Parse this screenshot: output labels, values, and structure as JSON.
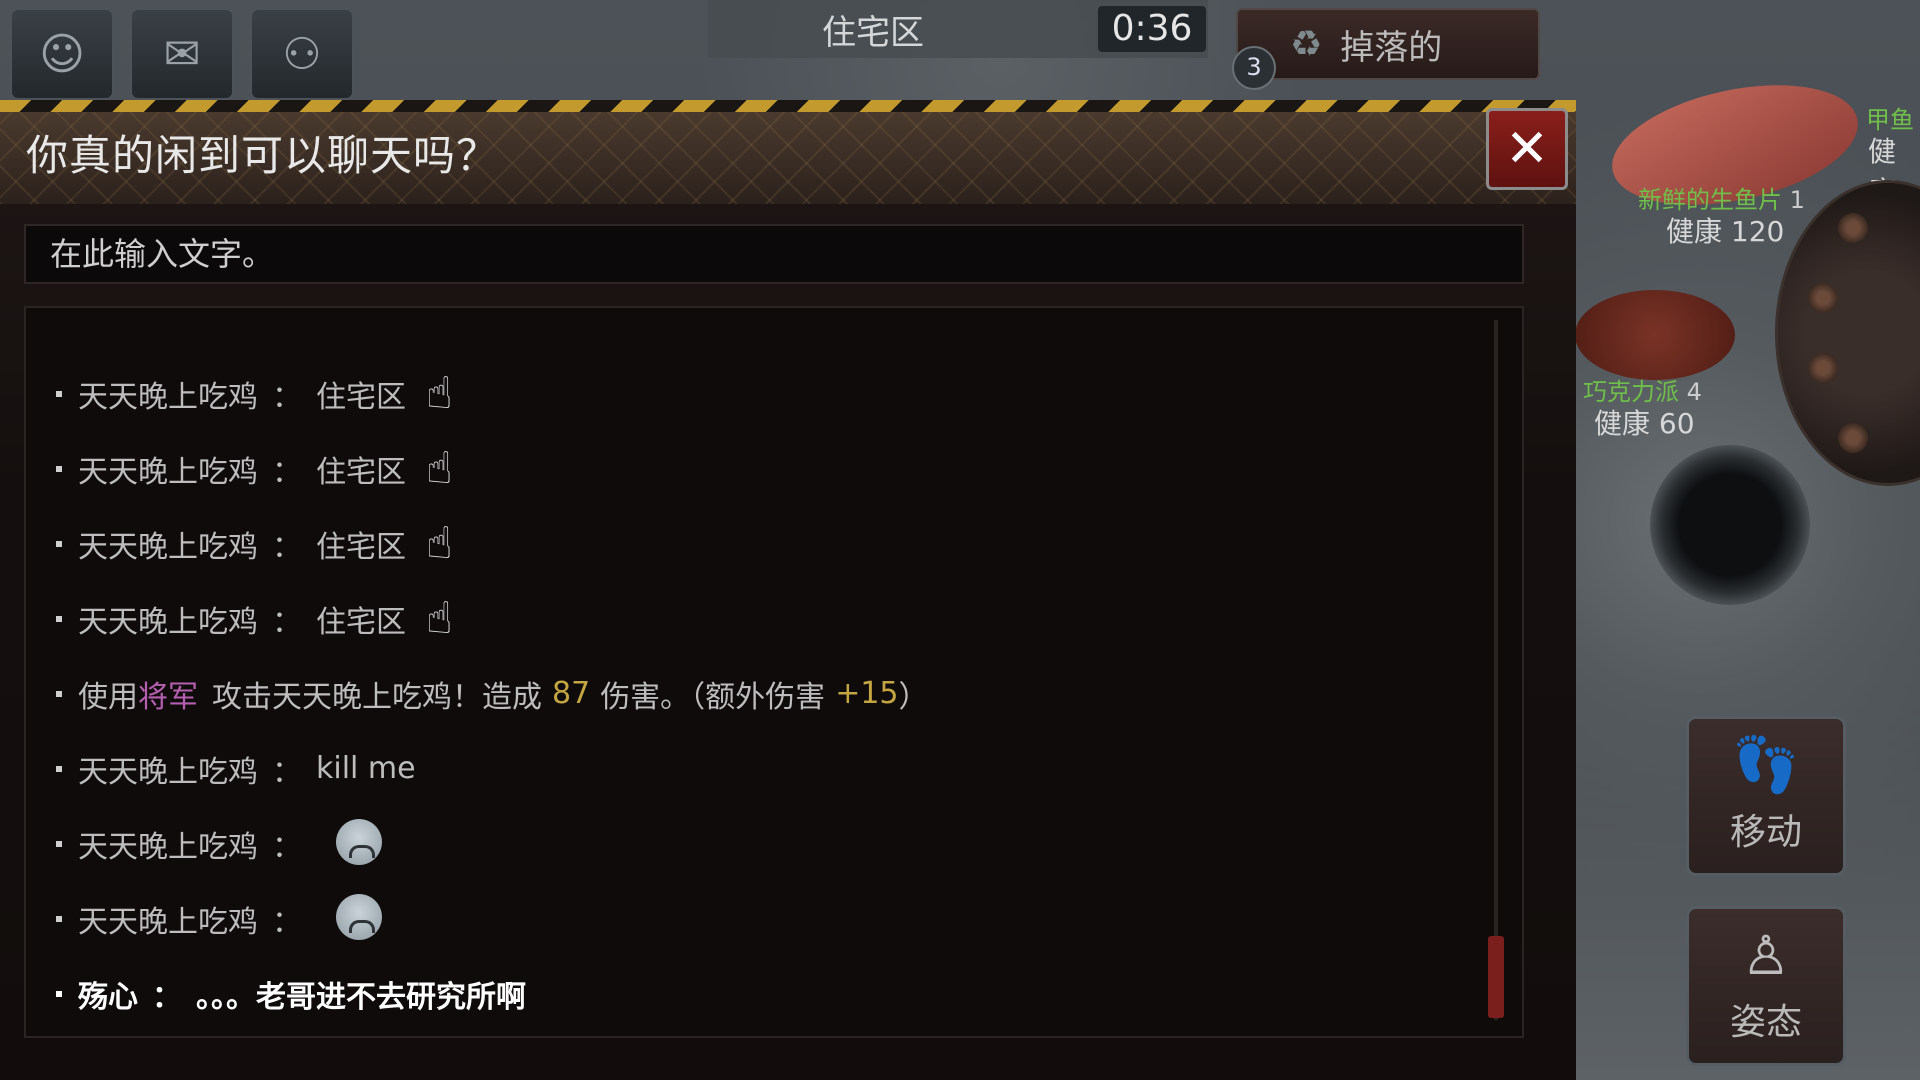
{
  "hud": {
    "top_icons": [
      "face-icon",
      "chat-bubble-icon",
      "people-icon"
    ],
    "location": "住宅区",
    "timer": "0:36",
    "drop_button": {
      "label": "掉落的",
      "count": "3"
    }
  },
  "right_panel": {
    "items": [
      {
        "name": "新鲜的生鱼片",
        "qty": "1",
        "health_label": "健康",
        "health": "120"
      },
      {
        "name": "巧克力派",
        "qty": "4",
        "health_label": "健康",
        "health": "60"
      }
    ],
    "partial_item_name": "甲鱼",
    "partial_health_label": "健康",
    "actions": [
      {
        "label": "移动",
        "icon": "footprints-icon"
      },
      {
        "label": "姿态",
        "icon": "person-icon"
      }
    ]
  },
  "chat": {
    "title": "你真的闲到可以聊天吗？",
    "close_symbol": "✕",
    "input_placeholder": "在此输入文字。",
    "messages": [
      {
        "sender": "天天晚上吃鸡",
        "sep": "：",
        "text": "住宅区",
        "emoji": "hand-icon"
      },
      {
        "sender": "天天晚上吃鸡",
        "sep": "：",
        "text": "住宅区",
        "emoji": "hand-icon"
      },
      {
        "sender": "天天晚上吃鸡",
        "sep": "：",
        "text": "住宅区",
        "emoji": "hand-icon"
      },
      {
        "sender": "天天晚上吃鸡",
        "sep": "：",
        "text": "住宅区",
        "emoji": "hand-icon"
      },
      {
        "sender": "天天晚上吃鸡",
        "sep": "：",
        "text": "kill me",
        "emoji": ""
      },
      {
        "sender": "天天晚上吃鸡",
        "sep": "：",
        "text": "",
        "emoji": "crying-face-icon"
      },
      {
        "sender": "天天晚上吃鸡",
        "sep": "：",
        "text": "",
        "emoji": "crying-face-icon"
      }
    ],
    "combat_message": {
      "prefix": "使用",
      "weapon": "将军",
      "middle": "攻击天天晚上吃鸡！造成",
      "damage": "87",
      "suffix": "伤害。（额外伤害",
      "bonus": "+15",
      "close": "）"
    },
    "last_message": {
      "sender": "殇心",
      "sep": "：",
      "text": "。。。老哥进不去研究所啊"
    },
    "hand_glyph": "☝",
    "colors": {
      "weapon": "#b55fb0",
      "number": "#c3a642",
      "scroll_thumb": "#7a1f1c"
    }
  }
}
